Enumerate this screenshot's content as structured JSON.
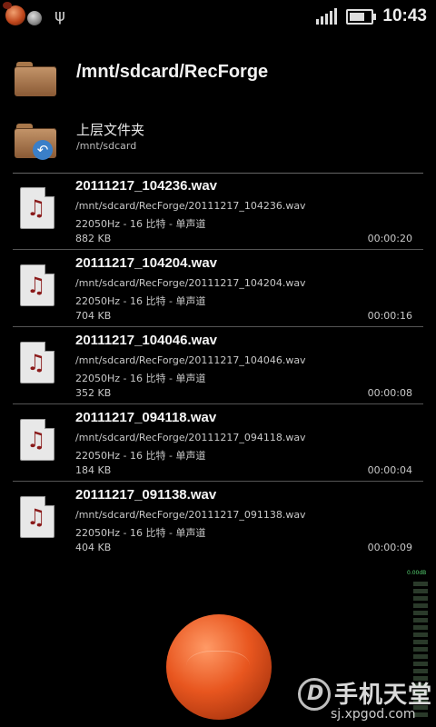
{
  "status_bar": {
    "time": "10:43",
    "icons": [
      "app-ball-icon",
      "usb-icon",
      "signal-icon",
      "battery-icon"
    ]
  },
  "current_path": {
    "title": "/mnt/sdcard/RecForge"
  },
  "parent_folder": {
    "title": "上层文件夹",
    "path": "/mnt/sdcard"
  },
  "files": [
    {
      "name": "20111217_104236.wav",
      "path": "/mnt/sdcard/RecForge/20111217_104236.wav",
      "info": "22050Hz - 16 比特 - 单声道",
      "size": "882 KB",
      "duration": "00:00:20"
    },
    {
      "name": "20111217_104204.wav",
      "path": "/mnt/sdcard/RecForge/20111217_104204.wav",
      "info": "22050Hz - 16 比特 - 单声道",
      "size": "704 KB",
      "duration": "00:00:16"
    },
    {
      "name": "20111217_104046.wav",
      "path": "/mnt/sdcard/RecForge/20111217_104046.wav",
      "info": "22050Hz - 16 比特 - 单声道",
      "size": "352 KB",
      "duration": "00:00:08"
    },
    {
      "name": "20111217_094118.wav",
      "path": "/mnt/sdcard/RecForge/20111217_094118.wav",
      "info": "22050Hz - 16 比特 - 单声道",
      "size": "184 KB",
      "duration": "00:00:04"
    },
    {
      "name": "20111217_091138.wav",
      "path": "/mnt/sdcard/RecForge/20111217_091138.wav",
      "info": "22050Hz - 16 比特 - 单声道",
      "size": "404 KB",
      "duration": "00:00:09"
    }
  ],
  "level_meter": {
    "label": "0.00dB"
  },
  "watermark": {
    "title": "手机天堂",
    "url": "sj.xpgod.com"
  },
  "colors": {
    "background": "#000000",
    "record_button": "#e8561f",
    "meter_label": "#55d070"
  }
}
